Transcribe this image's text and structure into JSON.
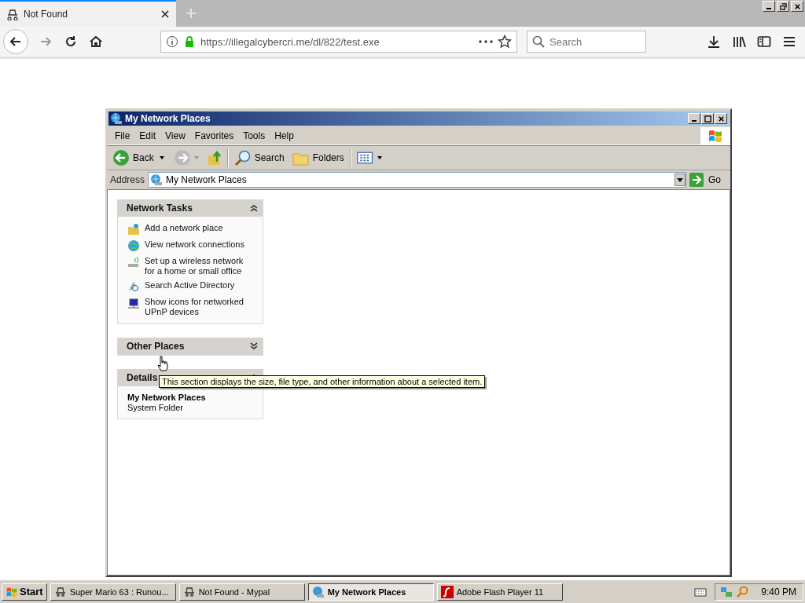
{
  "browser": {
    "tabs": [
      {
        "title": "Not Found",
        "selected": true
      }
    ],
    "url": "https://illegalcybercri.me/dl/822/test.exe",
    "search": {
      "placeholder": "Search"
    }
  },
  "window": {
    "title": "My Network Places",
    "menu": [
      "File",
      "Edit",
      "View",
      "Favorites",
      "Tools",
      "Help"
    ],
    "toolbar": {
      "back": "Back",
      "search": "Search",
      "folders": "Folders"
    },
    "address": {
      "label": "Address",
      "value": "My Network Places",
      "go": "Go"
    },
    "panels": [
      {
        "kind": "links",
        "title": "Network Tasks",
        "expanded": true,
        "items": [
          {
            "text": "Add a network place"
          },
          {
            "text": "View network connections"
          },
          {
            "text": "Set up a wireless network for a home or small office"
          },
          {
            "text": "Search Active Directory"
          },
          {
            "text": "Show icons for networked UPnP devices"
          }
        ]
      },
      {
        "title": "Other Places",
        "expanded": false
      },
      {
        "kind": "details",
        "title": "Details",
        "expanded": true,
        "name": "My Network Places",
        "type": "System Folder",
        "tooltip": "This section displays the size, file type, and other information about a selected item."
      }
    ]
  },
  "taskbar": {
    "start": "Start",
    "items": [
      {
        "label": "Super Mario 63 : Runou...",
        "selected": false
      },
      {
        "label": "Not Found - Mypal",
        "selected": false
      },
      {
        "label": "My Network Places",
        "selected": true
      },
      {
        "label": "Adobe Flash Player 11",
        "selected": false
      }
    ],
    "clock": "9:40 PM"
  }
}
